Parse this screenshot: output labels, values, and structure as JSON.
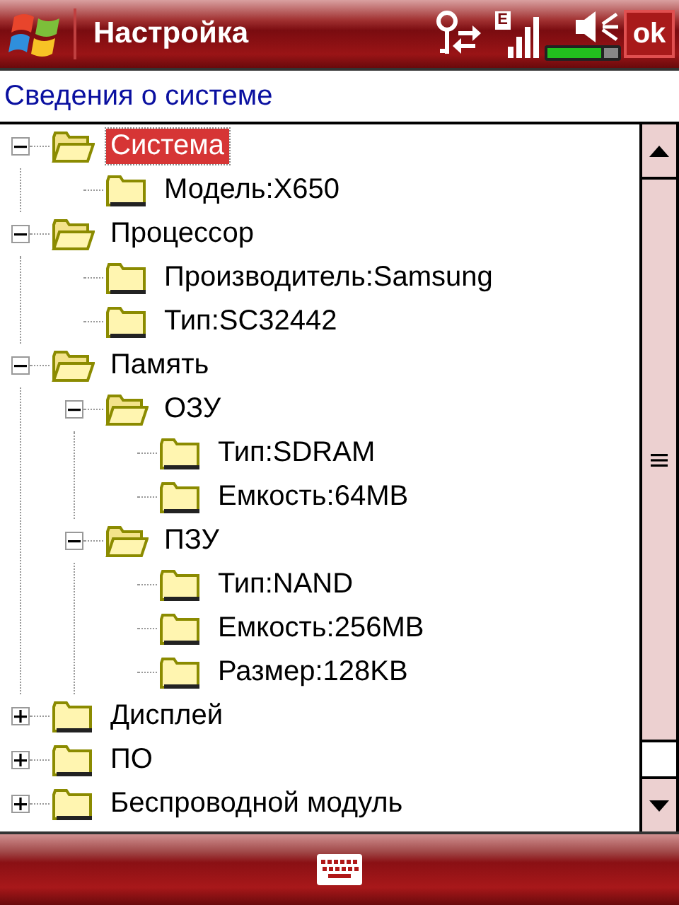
{
  "window": {
    "title": "Настройка",
    "network_type": "E",
    "ok_button": "ok"
  },
  "heading": "Сведения о системе",
  "tree": [
    {
      "label": "Система",
      "selected": true,
      "expanded": true,
      "children": [
        {
          "label": "Модель:X650",
          "selected": false
        }
      ]
    },
    {
      "label": "Процессор",
      "selected": false,
      "expanded": true,
      "children": [
        {
          "label": "Производитель:Samsung",
          "selected": false
        },
        {
          "label": "Тип:SC32442",
          "selected": false
        }
      ]
    },
    {
      "label": "Память",
      "selected": false,
      "expanded": true,
      "children": [
        {
          "label": "ОЗУ",
          "selected": false,
          "expanded": true,
          "children": [
            {
              "label": "Тип:SDRAM",
              "selected": false
            },
            {
              "label": "Емкость:64MB",
              "selected": false
            }
          ]
        },
        {
          "label": "ПЗУ",
          "selected": false,
          "expanded": true,
          "children": [
            {
              "label": "Тип:NAND",
              "selected": false
            },
            {
              "label": "Емкость:256MB",
              "selected": false
            },
            {
              "label": "Размер:128KB",
              "selected": false
            }
          ]
        }
      ]
    },
    {
      "label": "Дисплей",
      "selected": false,
      "expanded": false
    },
    {
      "label": "ПО",
      "selected": false,
      "expanded": false
    },
    {
      "label": "Беспроводной модуль",
      "selected": false,
      "expanded": false
    }
  ]
}
